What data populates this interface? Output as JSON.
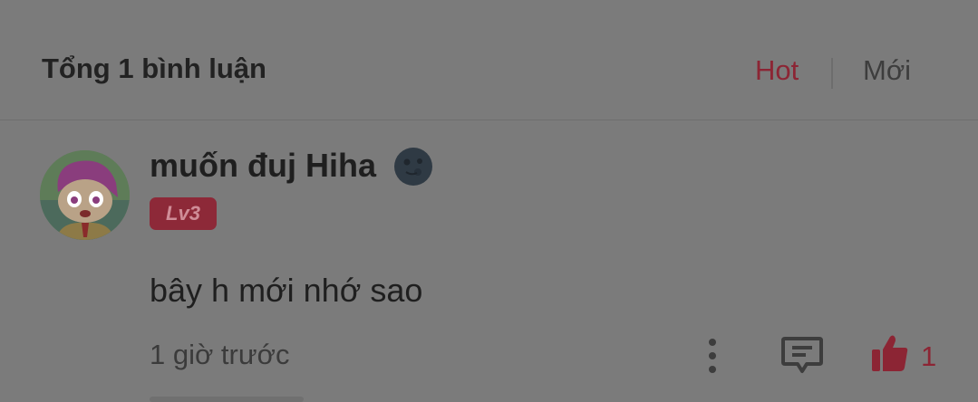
{
  "header": {
    "total_label": "Tổng 1 bình luận",
    "sort_options": [
      "Hot",
      "Mới"
    ],
    "selected_sort": "Hot"
  },
  "comment": {
    "username": "muốn đuj Hiha",
    "badge_icon": "moon-face-icon",
    "level": "Lv3",
    "text": "bây h mới nhớ sao",
    "time": "1 giờ trước",
    "likes": "1"
  },
  "icons": {
    "more": "more-vertical-icon",
    "reply": "comment-reply-icon",
    "like": "thumbs-up-icon"
  },
  "colors": {
    "accent": "#8c2534",
    "background": "#7b7b7b"
  }
}
